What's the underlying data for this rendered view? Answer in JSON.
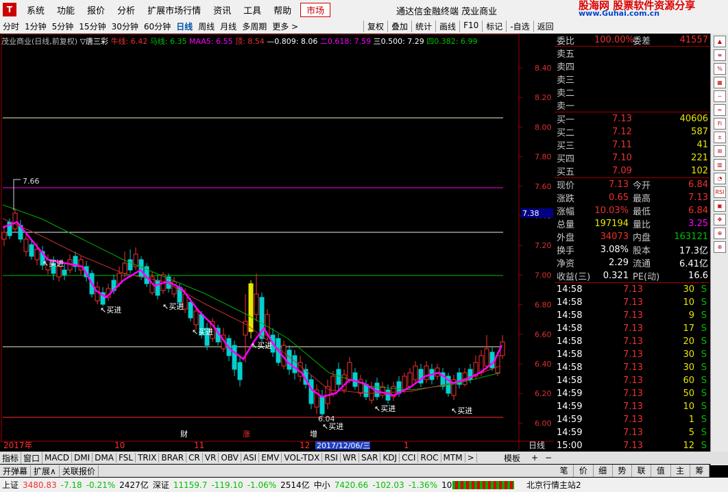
{
  "menu": {
    "logo": "T",
    "items": [
      "系统",
      "功能",
      "报价",
      "分析",
      "扩展市场行情",
      "资讯",
      "工具",
      "帮助"
    ],
    "market": "市场",
    "title": "通达信金融终端 茂业商业",
    "brand_cn": "股海网 股票软件资源分享",
    "brand_url": "www.Guhai.com.cn"
  },
  "periods": [
    "分时",
    "1分钟",
    "5分钟",
    "15分钟",
    "30分钟",
    "60分钟",
    "日线",
    "周线",
    "月线",
    "多周期",
    "更多 >"
  ],
  "tools": [
    "复权",
    "叠加",
    "统计",
    "画线",
    "F10",
    "标记",
    "-自选",
    "返回"
  ],
  "legend": {
    "title": "茂业商业(日线,前复权)",
    "indicator": "▽唐三彩",
    "niu": "牛线: 6.42",
    "ma": "马线: 6.35",
    "maa": "MAA5: 6.55",
    "top": "顶: 8.54",
    "l1": "—0.809: 8.06",
    "l2": "二0.618: 7.59",
    "l3": "三0.500: 7.29",
    "l4": "四0.382: 6.99"
  },
  "chart": {
    "price_axis": [
      "8.40",
      "8.20",
      "8.00",
      "7.80",
      "7.60",
      "7.40",
      "7.20",
      "7.00",
      "6.80",
      "6.60",
      "6.40",
      "6.20",
      "6.00"
    ],
    "cursor_price": "7.38",
    "high_label": "7.66",
    "low_label": "6.04",
    "buy_label": "买进",
    "year_label": "2017年",
    "months": [
      "10",
      "11",
      "12",
      "1"
    ],
    "date_tag": "2017/12/06/三",
    "events": [
      "财",
      "涨",
      "增"
    ],
    "axis_label": "日线",
    "plus": "+",
    "minus": "−"
  },
  "quote": {
    "wb_label": "委比",
    "wb": "100.00%",
    "wc_label": "委差",
    "wc": "41557",
    "sell": [
      "卖五",
      "卖四",
      "卖三",
      "卖二",
      "卖一"
    ],
    "buy": [
      {
        "l": "买一",
        "p": "7.13",
        "v": "40606"
      },
      {
        "l": "买二",
        "p": "7.12",
        "v": "587"
      },
      {
        "l": "买三",
        "p": "7.11",
        "v": "41"
      },
      {
        "l": "买四",
        "p": "7.10",
        "v": "221"
      },
      {
        "l": "买五",
        "p": "7.09",
        "v": "102"
      }
    ],
    "stats": [
      {
        "a": "现价",
        "av": "7.13",
        "b": "今开",
        "bv": "6.84"
      },
      {
        "a": "涨跌",
        "av": "0.65",
        "b": "最高",
        "bv": "7.13"
      },
      {
        "a": "涨幅",
        "av": "10.03%",
        "b": "最低",
        "bv": "6.84"
      },
      {
        "a": "总量",
        "av": "197194",
        "b": "量比",
        "bv": "3.25"
      },
      {
        "a": "外盘",
        "av": "34073",
        "b": "内盘",
        "bv": "163121"
      },
      {
        "a": "换手",
        "av": "3.08%",
        "b": "股本",
        "bv": "17.3亿"
      },
      {
        "a": "净资",
        "av": "2.29",
        "b": "流通",
        "bv": "6.41亿"
      },
      {
        "a": "收益(三)",
        "av": "0.321",
        "b": "PE(动)",
        "bv": "16.6"
      }
    ],
    "ticks": [
      [
        "14:58",
        "7.13",
        "30",
        "S"
      ],
      [
        "14:58",
        "7.13",
        "10",
        "S"
      ],
      [
        "14:58",
        "7.13",
        "9",
        "S"
      ],
      [
        "14:58",
        "7.13",
        "17",
        "S"
      ],
      [
        "14:58",
        "7.13",
        "20",
        "S"
      ],
      [
        "14:58",
        "7.13",
        "30",
        "S"
      ],
      [
        "14:58",
        "7.13",
        "30",
        "S"
      ],
      [
        "14:58",
        "7.13",
        "60",
        "S"
      ],
      [
        "14:59",
        "7.13",
        "50",
        "S"
      ],
      [
        "14:59",
        "7.13",
        "10",
        "S"
      ],
      [
        "14:59",
        "7.13",
        "1",
        "S"
      ],
      [
        "14:59",
        "7.13",
        "5",
        "S"
      ],
      [
        "15:00",
        "7.13",
        "12",
        "S"
      ]
    ]
  },
  "tabs": [
    "指标",
    "窗口",
    "MACD",
    "DMI",
    "DMA",
    "FSL",
    "TRIX",
    "BRAR",
    "CR",
    "VR",
    "OBV",
    "ASI",
    "EMV",
    "VOL-TDX",
    "RSI",
    "WR",
    "SAR",
    "KDJ",
    "CCI",
    "ROC",
    "MTM",
    ">"
  ],
  "tabs_right": "模板",
  "sub": [
    "开弹幕",
    "扩展∧",
    "关联报价"
  ],
  "rtabs": [
    "笔",
    "价",
    "细",
    "势",
    "联",
    "值",
    "主",
    "筹"
  ],
  "status": {
    "sh": "上证",
    "sh_v": "3480.83",
    "sh_c": "-7.18",
    "sh_p": "-0.21%",
    "sh_a": "2427亿",
    "sz": "深证",
    "sz_v": "11159.7",
    "sz_c": "-119.10",
    "sz_p": "-1.06%",
    "sz_a": "2514亿",
    "zx": "中小",
    "zx_v": "7420.66",
    "zx_c": "-102.03",
    "zx_p": "-1.36%",
    "zx_a": "1004亿",
    "srv": "北京行情主站2"
  }
}
